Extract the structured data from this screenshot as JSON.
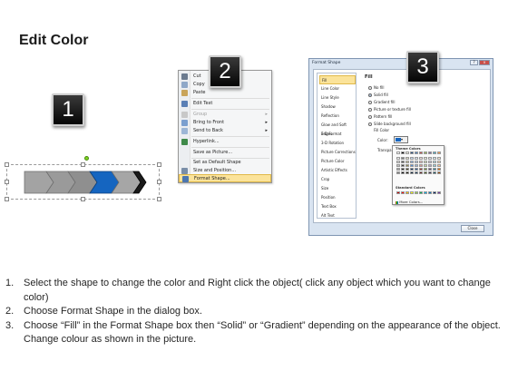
{
  "page": {
    "title": "Edit Color"
  },
  "badges": [
    "1",
    "2",
    "3"
  ],
  "colors": {
    "chevron_gray": "#9e9e9e",
    "chevron_selected": "#1565c0",
    "highlight": "#fbe39a",
    "dialog_bg": "#d9e4f1",
    "badge_bg": "#111111"
  },
  "context_menu": {
    "items": [
      {
        "label": "Cut",
        "icon": "scissors-icon",
        "disabled": false
      },
      {
        "label": "Copy",
        "icon": "copy-icon",
        "disabled": false
      },
      {
        "label": "Paste",
        "icon": "paste-icon",
        "disabled": false
      },
      {
        "label": "Edit Text",
        "icon": "edit-text-icon",
        "disabled": false
      },
      {
        "label": "Group",
        "icon": "group-icon",
        "disabled": true,
        "submenu": true
      },
      {
        "label": "Bring to Front",
        "icon": "bring-front-icon",
        "disabled": false,
        "submenu": true
      },
      {
        "label": "Send to Back",
        "icon": "send-back-icon",
        "disabled": false,
        "submenu": true
      },
      {
        "label": "Hyperlink...",
        "icon": "hyperlink-icon",
        "disabled": false
      },
      {
        "label": "Save as Picture...",
        "icon": "",
        "disabled": false
      },
      {
        "label": "Set as Default Shape",
        "icon": "",
        "disabled": false
      },
      {
        "label": "Size and Position...",
        "icon": "size-position-icon",
        "disabled": false
      },
      {
        "label": "Format Shape...",
        "icon": "format-shape-icon",
        "disabled": false,
        "highlighted": true
      }
    ]
  },
  "dialog": {
    "title": "Format Shape",
    "nav_items": [
      "Fill",
      "Line Color",
      "Line Style",
      "Shadow",
      "Reflection",
      "Glow and Soft Edges",
      "3-D Format",
      "3-D Rotation",
      "Picture Corrections",
      "Picture Color",
      "Artistic Effects",
      "Crop",
      "Size",
      "Position",
      "Text Box",
      "Alt Text"
    ],
    "heading": "Fill",
    "fill_options": [
      {
        "label": "No fill",
        "selected": false
      },
      {
        "label": "Solid fill",
        "selected": true
      },
      {
        "label": "Gradient fill",
        "selected": false
      },
      {
        "label": "Picture or texture fill",
        "selected": false
      },
      {
        "label": "Pattern fill",
        "selected": false
      },
      {
        "label": "Slide background fill",
        "selected": false
      }
    ],
    "fill_color_label": "Fill Color",
    "color_label": "Color:",
    "transparency_label": "Transpa",
    "palette": {
      "theme_label": "Theme Colors",
      "standard_label": "Standard Colors",
      "more_label": "More Colors...",
      "theme_row": [
        "#ffffff",
        "#000000",
        "#eeece1",
        "#1f497d",
        "#4f81bd",
        "#c0504d",
        "#9bbb59",
        "#8064a2",
        "#4bacc6",
        "#f79646"
      ],
      "shade_rows": [
        [
          "#f2f2f2",
          "#7f7f7f",
          "#ddd9c3",
          "#c6d9f0",
          "#dbe5f1",
          "#f2dcdb",
          "#ebf1dd",
          "#e5e0ec",
          "#dbeef3",
          "#fdeada"
        ],
        [
          "#d8d8d8",
          "#595959",
          "#c4bd97",
          "#8db3e2",
          "#b8cce4",
          "#e5b9b7",
          "#d7e3bc",
          "#ccc1d9",
          "#b7dde8",
          "#fbd5b5"
        ],
        [
          "#bfbfbf",
          "#3f3f3f",
          "#938953",
          "#548dd4",
          "#95b3d7",
          "#d99694",
          "#c3d69b",
          "#b2a2c7",
          "#92cddc",
          "#fac08f"
        ],
        [
          "#a5a5a5",
          "#262626",
          "#494429",
          "#17365d",
          "#366092",
          "#953734",
          "#76923c",
          "#5f497a",
          "#31859b",
          "#e36c09"
        ],
        [
          "#7f7f7f",
          "#0c0c0c",
          "#1d1b10",
          "#0f243e",
          "#244061",
          "#632423",
          "#4f6128",
          "#3f3151",
          "#205867",
          "#974806"
        ]
      ],
      "standard_row": [
        "#c00000",
        "#ff0000",
        "#ffc000",
        "#ffff00",
        "#92d050",
        "#00b050",
        "#00b0f0",
        "#0070c0",
        "#002060",
        "#7030a0"
      ]
    },
    "close_label": "Close"
  },
  "instructions": [
    {
      "num": "1.",
      "text": "Select the shape to change the color and Right click the object( click any object which you want to change color)"
    },
    {
      "num": "2.",
      "text": "Choose Format Shape in the dialog box."
    },
    {
      "num": "3.",
      "text": "Choose “Fill” in the Format Shape box then “Solid” or “Gradient” depending on the appearance of the object. Change colour as shown in the picture."
    }
  ]
}
